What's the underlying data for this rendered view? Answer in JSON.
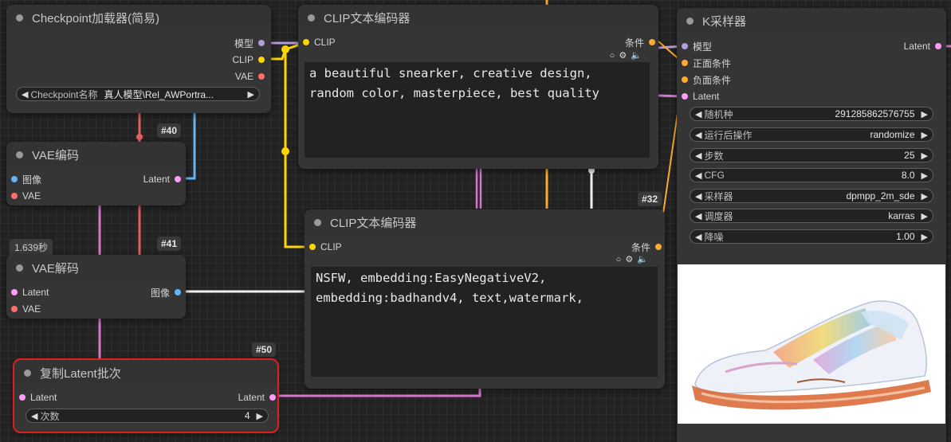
{
  "colors": {
    "model": "#b39ddb",
    "clip": "#ffd500",
    "vae": "#ff6e6e",
    "latent": "#ff9cf9",
    "image": "#64b5f6",
    "conditioning": "#ffa931",
    "selection": "#e0201b"
  },
  "nodes": {
    "checkpoint": {
      "title": "Checkpoint加载器(简易)",
      "out_model": "模型",
      "out_clip": "CLIP",
      "out_vae": "VAE",
      "ckpt_label": "Checkpoint名称",
      "ckpt_value": "真人模型\\Rel_AWPortra..."
    },
    "vae_encode": {
      "badge": "#40",
      "title": "VAE编码",
      "in_image": "图像",
      "in_vae": "VAE",
      "out_latent": "Latent"
    },
    "vae_decode": {
      "time": "1.639秒",
      "badge": "#41",
      "title": "VAE解码",
      "in_latent": "Latent",
      "in_vae": "VAE",
      "out_image": "图像"
    },
    "latent_batch": {
      "badge": "#50",
      "title": "复制Latent批次",
      "in_latent": "Latent",
      "out_latent": "Latent",
      "count_label": "次数",
      "count_value": "4"
    },
    "clip_pos": {
      "title": "CLIP文本编码器",
      "in_clip": "CLIP",
      "out_cond": "条件",
      "text": "a beautiful snearker, creative design,\nrandom color, masterpiece, best quality"
    },
    "clip_neg": {
      "badge": "#32",
      "title": "CLIP文本编码器",
      "in_clip": "CLIP",
      "out_cond": "条件",
      "text": "NSFW, embedding:EasyNegativeV2,\nembedding:badhandv4, text,watermark,"
    },
    "ksampler": {
      "title": "K采样器",
      "in_model": "模型",
      "in_positive": "正面条件",
      "in_negative": "负面条件",
      "in_latent": "Latent",
      "out_latent": "Latent",
      "widgets": [
        {
          "label": "随机种",
          "value": "291285862576755"
        },
        {
          "label": "运行后操作",
          "value": "randomize"
        },
        {
          "label": "步数",
          "value": "25"
        },
        {
          "label": "CFG",
          "value": "8.0"
        },
        {
          "label": "采样器",
          "value": "dpmpp_2m_sde"
        },
        {
          "label": "调度器",
          "value": "karras"
        },
        {
          "label": "降噪",
          "value": "1.00"
        }
      ]
    }
  }
}
